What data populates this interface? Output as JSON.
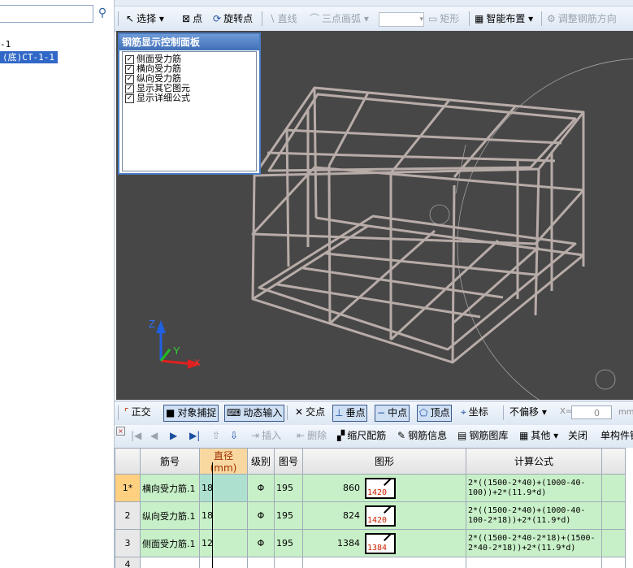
{
  "tree": {
    "item1": "-1",
    "item2": "(底)CT-1-1"
  },
  "toolbar_top": {
    "select": "选择",
    "point": "点",
    "rotate_point": "旋转点",
    "line": "直线",
    "arc": "三点画弧",
    "rect": "矩形",
    "smart_layout": "智能布置",
    "adjust_direction": "调整钢筋方向"
  },
  "control_panel": {
    "title": "钢筋显示控制面板",
    "options": [
      {
        "label": "侧面受力筋",
        "checked": true
      },
      {
        "label": "横向受力筋",
        "checked": true
      },
      {
        "label": "纵向受力筋",
        "checked": true
      },
      {
        "label": "显示其它图元",
        "checked": true
      },
      {
        "label": "显示详细公式",
        "checked": true
      }
    ]
  },
  "axes": {
    "z": "Z",
    "y": "Y",
    "x": "X"
  },
  "status_toolbar": {
    "ortho": "正交",
    "snap": "对象捕捉",
    "dynamic_input": "动态输入",
    "intersection": "交点",
    "perpendicular": "垂点",
    "midpoint": "中点",
    "vertex": "顶点",
    "coordinate": "坐标",
    "offset_mode": "不偏移",
    "x_label": "X=",
    "x_value": "0",
    "unit": "mm"
  },
  "grid_toolbar": {
    "insert": "插入",
    "delete": "删除",
    "scale_bar": "缩尺配筋",
    "rebar_info": "钢筋信息",
    "rebar_library": "钢筋图库",
    "other": "其他",
    "close": "关闭",
    "single_member": "单构件钢"
  },
  "table": {
    "headers": [
      "筋号",
      "直径(mm)",
      "级别",
      "图号",
      "图形",
      "计算公式"
    ],
    "rows": [
      {
        "row_no": "1*",
        "name": "横向受力筋.1",
        "diameter": "18",
        "grade": "Φ",
        "fig_no": "195",
        "length": "860",
        "shape_value": "1420",
        "formula": "2*((1500-2*40)+(1000-40-100))+2*(11.9*d)"
      },
      {
        "row_no": "2",
        "name": "纵向受力筋.1",
        "diameter": "18",
        "grade": "Φ",
        "fig_no": "195",
        "length": "824",
        "shape_value": "1420",
        "formula": "2*((1500-2*40)+(1000-40-100-2*18))+2*(11.9*d)"
      },
      {
        "row_no": "3",
        "name": "侧面受力筋.1",
        "diameter": "12",
        "grade": "Φ",
        "fig_no": "195",
        "length": "1384",
        "shape_value": "1384",
        "formula": "2*((1500-2*40-2*18)+(1500-2*40-2*18))+2*(11.9*d)"
      },
      {
        "row_no": "4",
        "name": "",
        "diameter": "",
        "grade": "",
        "fig_no": "",
        "length": "",
        "shape_value": "",
        "formula": ""
      }
    ]
  }
}
